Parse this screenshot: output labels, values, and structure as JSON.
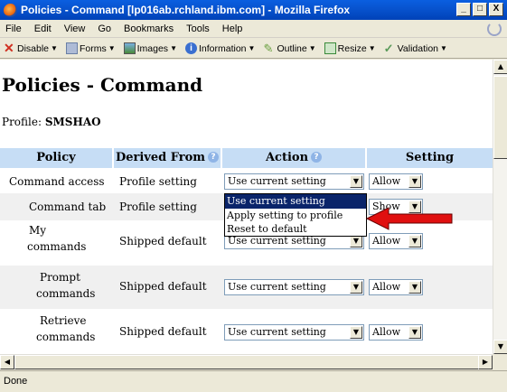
{
  "window": {
    "title": "Policies - Command [lp016ab.rchland.ibm.com] - Mozilla Firefox",
    "minimize": "_",
    "maximize": "□",
    "close": "X"
  },
  "menu": [
    "File",
    "Edit",
    "View",
    "Go",
    "Bookmarks",
    "Tools",
    "Help"
  ],
  "toolbar": [
    {
      "label": "Disable",
      "icon": "disable-icon",
      "color": "#d03020"
    },
    {
      "label": "Forms",
      "icon": "forms-icon",
      "color": "#7a8fb5"
    },
    {
      "label": "Images",
      "icon": "images-icon",
      "color": "#4a8a3a"
    },
    {
      "label": "Information",
      "icon": "information-icon",
      "color": "#3a6fd0"
    },
    {
      "label": "Outline",
      "icon": "outline-icon",
      "color": "#6aa040"
    },
    {
      "label": "Resize",
      "icon": "resize-icon",
      "color": "#3a8a3a"
    },
    {
      "label": "Validation",
      "icon": "validation-icon",
      "color": "#5a9a5a"
    }
  ],
  "page": {
    "title": "Policies - Command",
    "profile_label": "Profile:",
    "profile_value": "SMSHAO"
  },
  "table": {
    "headers": {
      "policy": "Policy",
      "derived": "Derived From",
      "action": "Action",
      "setting": "Setting"
    },
    "rows": [
      {
        "policy": "Command access",
        "derived": "Profile setting",
        "action": "Use current setting",
        "setting": "Allow"
      },
      {
        "policy": "Command tab",
        "derived": "Profile setting",
        "action": "",
        "setting": "Show"
      },
      {
        "policy_l1": "My",
        "policy_l2": "commands",
        "derived": "Shipped default",
        "action": "Use current setting",
        "setting": "Allow"
      },
      {
        "policy_l1": "Prompt",
        "policy_l2": "commands",
        "derived": "Shipped default",
        "action": "Use current setting",
        "setting": "Allow"
      },
      {
        "policy_l1": "Retrieve",
        "policy_l2": "commands",
        "derived": "Shipped default",
        "action": "Use current setting",
        "setting": "Allow"
      }
    ]
  },
  "dropdown_options": [
    "Use current setting",
    "Apply setting to profile",
    "Reset to default"
  ],
  "status": "Done",
  "accent_arrow_color": "#e01010"
}
